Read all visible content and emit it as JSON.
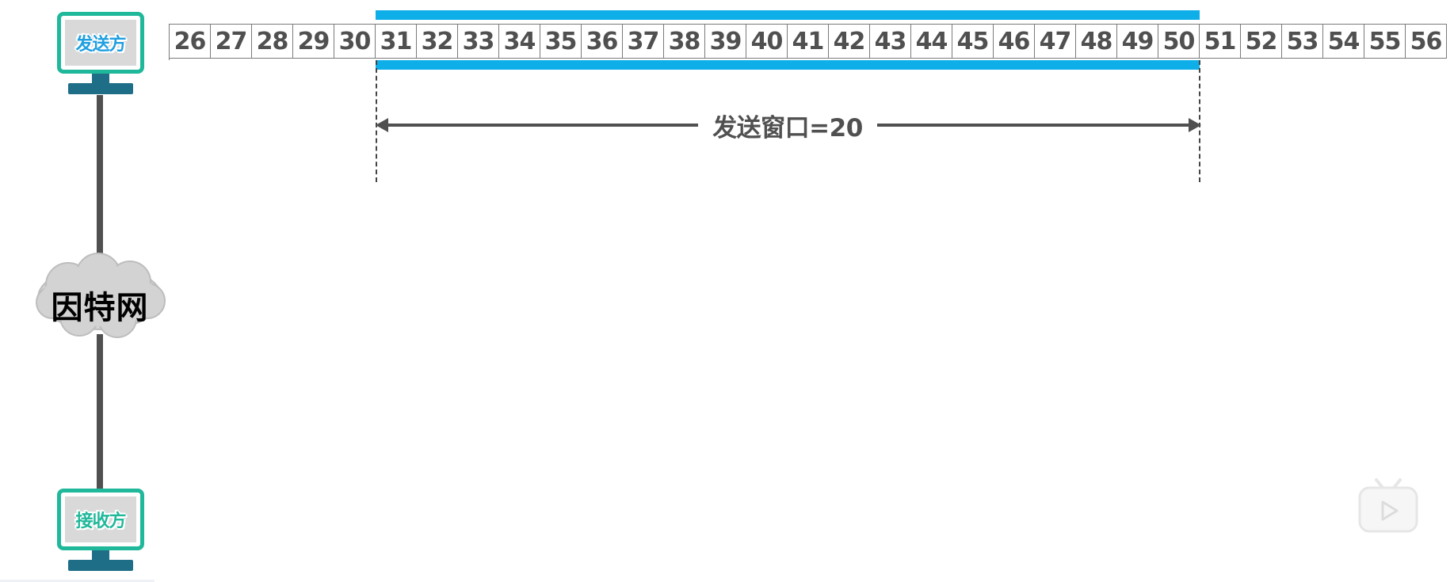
{
  "topology": {
    "sender_label": "发送方",
    "receiver_label": "接收方",
    "network_label": "因特网"
  },
  "sequence_numbers": [
    "26",
    "27",
    "28",
    "29",
    "30",
    "31",
    "32",
    "33",
    "34",
    "35",
    "36",
    "37",
    "38",
    "39",
    "40",
    "41",
    "42",
    "43",
    "44",
    "45",
    "46",
    "47",
    "48",
    "49",
    "50",
    "51",
    "52",
    "53",
    "54",
    "55",
    "56"
  ],
  "send_window": {
    "label": "发送窗口=20",
    "start": 31,
    "end": 50,
    "size": 20,
    "color": "#0eaee8"
  },
  "colors": {
    "device_border": "#20b89a",
    "device_stand": "#1f6e88",
    "cell_text": "#505050",
    "link_line": "#505050",
    "cloud_fill": "#d3d3d3"
  }
}
